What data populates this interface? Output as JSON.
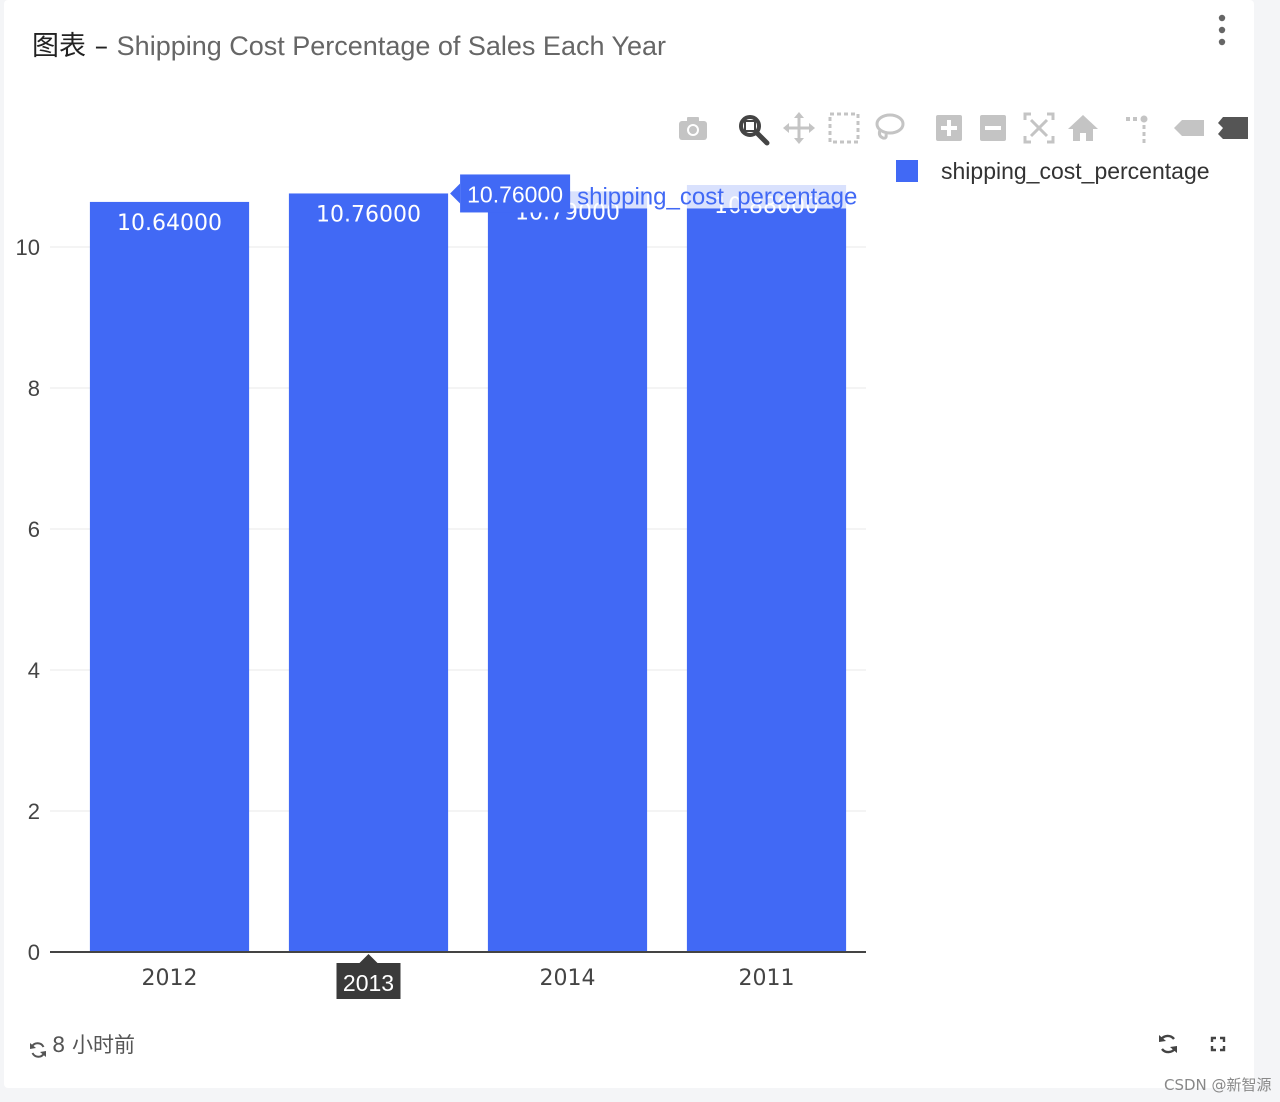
{
  "header": {
    "title_prefix": "图表 – ",
    "title": "Shipping Cost Percentage of Sales Each Year"
  },
  "toolbar": {
    "items": [
      {
        "icon": "camera-icon",
        "label": "Download plot as png"
      },
      {
        "icon": "zoom-icon",
        "label": "Zoom",
        "active": true
      },
      {
        "icon": "pan-icon",
        "label": "Pan"
      },
      {
        "icon": "box-select-icon",
        "label": "Box Select"
      },
      {
        "icon": "lasso-select-icon",
        "label": "Lasso Select"
      },
      {
        "icon": "zoom-in-icon",
        "label": "Zoom in"
      },
      {
        "icon": "zoom-out-icon",
        "label": "Zoom out"
      },
      {
        "icon": "autoscale-icon",
        "label": "Autoscale"
      },
      {
        "icon": "reset-axes-icon",
        "label": "Reset axes"
      },
      {
        "icon": "spike-lines-icon",
        "label": "Toggle Spike Lines"
      },
      {
        "icon": "hover-closest-icon",
        "label": "Show closest data on hover"
      },
      {
        "icon": "hover-compare-icon",
        "label": "Compare data on hover"
      }
    ]
  },
  "chart_data": {
    "type": "bar",
    "categories": [
      "2012",
      "2013",
      "2014",
      "2011"
    ],
    "series": [
      {
        "name": "shipping_cost_percentage",
        "values": [
          10.64,
          10.76,
          10.79,
          10.88
        ],
        "labels": [
          "10.64000",
          "10.76000",
          "10.79000",
          "10.88000"
        ],
        "color": "#4169f5"
      }
    ],
    "title": "",
    "xlabel": "",
    "ylabel": "",
    "ylim": [
      0,
      10.88
    ],
    "yticks": [
      "0",
      "2",
      "4",
      "6",
      "8",
      "10"
    ],
    "ytick_values": [
      0,
      2,
      4,
      6,
      8,
      10
    ],
    "grid": true,
    "legend_position": "top-right",
    "hover": {
      "category": "2013",
      "value_label": "10.76000",
      "series_name": "shipping_cost_percentage"
    }
  },
  "footer": {
    "refresh_time": "8 小时前"
  },
  "watermark": "CSDN @新智源",
  "colors": {
    "bar": "#4169f5",
    "grid": "#e9e9e9",
    "axis": "#444444",
    "toolbar_icon": "#c4c4c4",
    "toolbar_icon_active": "#444444"
  }
}
